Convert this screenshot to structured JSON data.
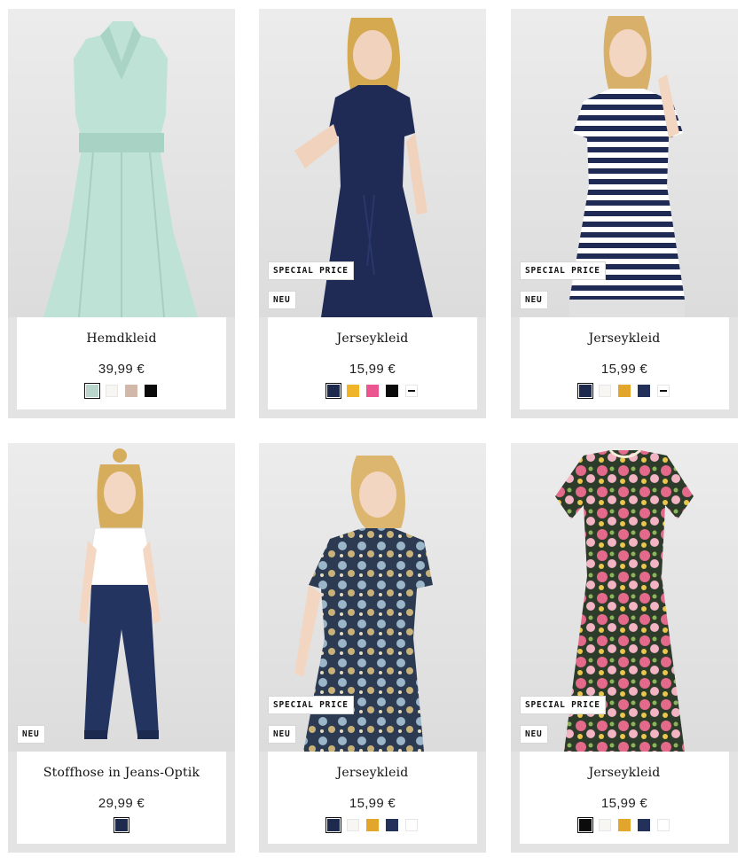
{
  "products": [
    {
      "name": "Hemdkleid",
      "price": "39,99 €",
      "special_tag": "",
      "new_tag": "",
      "swatches": [
        {
          "color": "#b9d6cc",
          "selected": true
        },
        {
          "color": "#f7f6f2",
          "selected": false
        },
        {
          "color": "#d2b8a8",
          "selected": false
        },
        {
          "color": "#0b0b0b",
          "selected": false
        }
      ],
      "image_icon": "mint-shirt-dress-image"
    },
    {
      "name": "Jerseykleid",
      "price": "15,99 €",
      "special_tag": "SPECIAL PRICE",
      "new_tag": "NEU",
      "swatches": [
        {
          "color": "#1d2a4d",
          "selected": true
        },
        {
          "color": "#f0b428",
          "selected": false
        },
        {
          "color": "#ec5690",
          "selected": false
        },
        {
          "color": "#0b0b0b",
          "selected": false
        },
        {
          "color": "#ffffff",
          "selected": false,
          "style": "minus"
        }
      ],
      "image_icon": "navy-jersey-dress-image"
    },
    {
      "name": "Jerseykleid",
      "price": "15,99 €",
      "special_tag": "SPECIAL PRICE",
      "new_tag": "NEU",
      "swatches": [
        {
          "color": "#1d2a4d",
          "selected": true
        },
        {
          "color": "#f7f6f2",
          "selected": false
        },
        {
          "color": "#e2a62d",
          "selected": false
        },
        {
          "color": "#22305a",
          "selected": false
        },
        {
          "color": "#ffffff",
          "selected": false,
          "style": "minus"
        }
      ],
      "image_icon": "striped-jersey-dress-image"
    },
    {
      "name": "Stoffhose in Jeans-Optik",
      "price": "29,99 €",
      "special_tag": "",
      "new_tag": "NEU",
      "swatches": [
        {
          "color": "#1d2a4d",
          "selected": true
        }
      ],
      "image_icon": "denim-look-trousers-image"
    },
    {
      "name": "Jerseykleid",
      "price": "15,99 €",
      "special_tag": "SPECIAL PRICE",
      "new_tag": "NEU",
      "swatches": [
        {
          "color": "#1d2a4d",
          "selected": true
        },
        {
          "color": "#f7f6f2",
          "selected": false
        },
        {
          "color": "#e2a62d",
          "selected": false
        },
        {
          "color": "#22305a",
          "selected": false
        },
        {
          "color": "#ffffff",
          "selected": false,
          "style": "bordered"
        }
      ],
      "image_icon": "paisley-jersey-dress-image"
    },
    {
      "name": "Jerseykleid",
      "price": "15,99 €",
      "special_tag": "SPECIAL PRICE",
      "new_tag": "NEU",
      "swatches": [
        {
          "color": "#0b0b0b",
          "selected": true
        },
        {
          "color": "#f7f6f2",
          "selected": false
        },
        {
          "color": "#e2a62d",
          "selected": false
        },
        {
          "color": "#22305a",
          "selected": false
        },
        {
          "color": "#ffffff",
          "selected": false,
          "style": "bordered"
        }
      ],
      "image_icon": "floral-jersey-dress-image"
    }
  ]
}
